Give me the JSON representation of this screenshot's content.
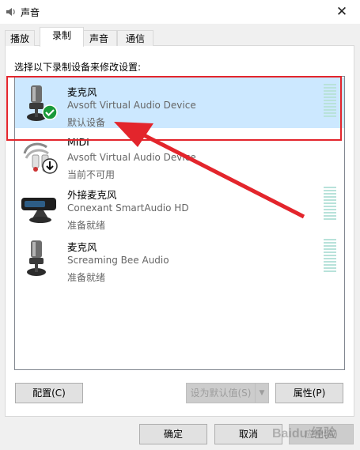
{
  "window": {
    "title": "声音",
    "close_glyph": "✕"
  },
  "tabs": [
    {
      "label": "播放"
    },
    {
      "label": "录制"
    },
    {
      "label": "声音"
    },
    {
      "label": "通信"
    }
  ],
  "instruction": "选择以下录制设备来修改设置:",
  "devices": [
    {
      "name": "麦克风",
      "description": "Avsoft Virtual Audio Device",
      "status": "默认设备",
      "icon": "microphone-icon",
      "badge": "check-badge-icon",
      "selected": true
    },
    {
      "name": "MIDI",
      "description": "Avsoft Virtual Audio Device",
      "status": "当前不可用",
      "icon": "midi-cable-icon",
      "badge": "down-arrow-badge-icon",
      "selected": false
    },
    {
      "name": "外接麦克风",
      "description": "Conexant SmartAudio HD",
      "status": "准备就绪",
      "icon": "external-mic-icon",
      "selected": false
    },
    {
      "name": "麦克风",
      "description": "Screaming Bee Audio",
      "status": "准备就绪",
      "icon": "microphone-icon",
      "selected": false
    }
  ],
  "buttons": {
    "configure": "配置(C)",
    "set_default": "设为默认值(S)",
    "properties": "属性(P)",
    "ok": "确定",
    "cancel": "取消",
    "apply": "应用(A)"
  },
  "watermark": {
    "text": "Baidu 经验"
  },
  "colors": {
    "selected_bg": "#cce8ff",
    "highlight_border": "#e3252c",
    "annotation_arrow": "#e3252c",
    "check_badge": "#1a9a3a",
    "meter": "#b8e2da"
  }
}
